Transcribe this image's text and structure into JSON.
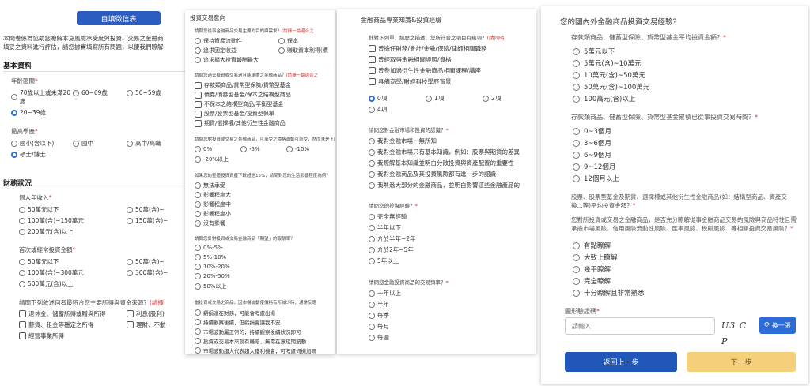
{
  "panel1": {
    "top_button": "自填徵信表",
    "intro1": "本問卷係為協助您瞭解本身風險承受度與投資、交易之金融商",
    "intro2": "填妥之資料進行評估，請您據實填寫所有問題，以便我們瞭解",
    "basic_title": "基本資料",
    "age_q": "年齡區間",
    "age_opts": [
      "70歲以上或未滿20歲",
      "60~69歲",
      "50~59歲",
      "20~39歲"
    ],
    "edu_q": "最高學歷",
    "edu_opts": [
      "國小(含以下)",
      "國中",
      "高中/高職",
      "碩士/博士"
    ],
    "finance_title": "財務狀況",
    "income_q": "個人年收入",
    "income_opts": [
      "50萬元以下",
      "50萬(含)~",
      "100萬(含)~150萬元",
      "150萬(含)~",
      "200萬元(含)以上"
    ],
    "first_q": "首次或經常投資金額",
    "first_opts": [
      "50萬元以下",
      "50萬(含)~",
      "100萬(含)~300萬元",
      "300萬(含)~",
      "500萬元(含)以上"
    ],
    "source_q": "請問下列敘述何者最符合您主要所得與資金來源？",
    "source_hint": "(請擇",
    "source_opts": [
      "退休金、儲蓄所得或贈與所得",
      "利息(股利)",
      "薪資、租金等穩定之所得",
      "理財、不動",
      "經營事業所得"
    ]
  },
  "panel2": {
    "title": "投資交易意向",
    "q1": "請問您從事金融商品交易主要的目的與需求？",
    "q1_hint": "(請擇一最適合之",
    "q1_opts": [
      "保持資產流動性",
      "保本",
      "追求固定收益",
      "賺取資本利得(價",
      "追求擴大投資報酬最大"
    ],
    "q2": "請問您過去投資或交易過且能承擔之金融商品？",
    "q2_hint": "(請擇一最適合之",
    "q2_opts": [
      "存款類商品/貨幣型保險/貨幣型基金",
      "債券/債券型基金/保本之結構型商品",
      "不保本之結構型商品/平衡型基金",
      "股票/股票型基金/投資型保單",
      "期貨/選擇權/其他衍生性金融商品"
    ],
    "q3": "請問您對投資或交易之金融商品，可承受之價格波動可承受，然而未是下跌",
    "q3_opts": [
      "0%",
      "-5%",
      "-10%",
      "-20%以上"
    ],
    "q4": "如果您的整體投資資產下跌超過15%，請問對您的生活影響程度為何？",
    "q4_opts": [
      "無法承受",
      "影響程度大",
      "影響程度中",
      "影響程度小",
      "沒有影響"
    ],
    "q5": "請問您針對投資或交易金融商品「期望」的報酬率？",
    "q5_opts": [
      "0%-5%",
      "5%-10%",
      "10%-20%",
      "20%-50%",
      "50%以上"
    ],
    "q6": "當投資或交易之商品，因市場波動使價格有所減少時，通常反應",
    "q6_opts": [
      "虧損達在財務，可能會考慮出場",
      "持續觀察後續，但虧損會讓我不安",
      "市場波動屬正常的，持續觀察後續狀況即可",
      "投資或交易本來就有賺賠，無需在意短期波動",
      "市場波動趨大代表趨大獲利機會，可考慮伺機加碼"
    ]
  },
  "panel3": {
    "title": "金融商品專業知識&投資經驗",
    "q1": "針對下列單，經歷之描述，您所符合之項目有幾項？",
    "q1_hint": "(請同時",
    "q1_opts": [
      "曾擔任財務/會計/金融/保險/律師相關職務",
      "曾經取得金融相關證照/資格",
      "曾參加過衍生性金融商品相關課程/講座",
      "具備商學/財經科技學歷背景"
    ],
    "q1_counts": [
      "0項",
      "1項",
      "2項",
      "4項"
    ],
    "q2": "請問您對金融市場和投資的認識？",
    "q2_opts": [
      "我對金融市場一無所知",
      "我對金融市場只有基本知識，例如：股票與期貨的差異",
      "我瞭解基本知識並明白分散投資與資產配置的重要性",
      "我對金融商品及其投資風險都有進一步的認識",
      "我熟悉大部分的金融商品，並明白影響這些金融產品的"
    ],
    "q3": "請問您的投資經驗？",
    "q3_opts": [
      "完全無經驗",
      "半年以下",
      "介於半年~2年",
      "介於2年~5年",
      "5年以上"
    ],
    "q4": "請問您金融投資商品的交易頻率？",
    "q4_opts": [
      "一年以上",
      "半年",
      "每季",
      "每月",
      "每週"
    ]
  },
  "panel4": {
    "title": "您的國內外金融商品投資交易經驗？",
    "q1": "存款類商品、儲蓄型保險、貨幣型基金平均投資金額？",
    "q1_opts": [
      "5萬元以下",
      "5萬元(含)~10萬元",
      "10萬元(含)~50萬元",
      "50萬元(含)~100萬元",
      "100萬元(含)以上"
    ],
    "q2": "存款類商品、儲蓄型保險、貨幣型基金累積已從事投資交易時間？",
    "q2_opts": [
      "0~3個月",
      "3~6個月",
      "6~9個月",
      "9~12個月",
      "12個月以上"
    ],
    "q3_line1": "股票、股票型基金及期貨、選擇權或其他衍生性金融商品(如：結構型商品、資產交",
    "q3_line2": "換...等)平均投資金額？",
    "q4_line1": "您對所投資或交易之金融商品，是否充分瞭解從事金融商品交易的風險與商品特性且需",
    "q4_line2": "承擔市場風險、信用風險流動性風險、匯率風險、稅賦風險...等相關投資交易風險？",
    "q4_opts": [
      "有點瞭解",
      "大致上瞭解",
      "幾乎瞭解",
      "完全瞭解",
      "十分瞭解且非常熟悉"
    ],
    "captcha_label": "圖形驗證碼",
    "captcha_placeholder": "請輸入",
    "captcha_text": "U3 C P",
    "refresh_label": "換一張",
    "back_label": "返回上一步",
    "next_label": "下一步"
  }
}
